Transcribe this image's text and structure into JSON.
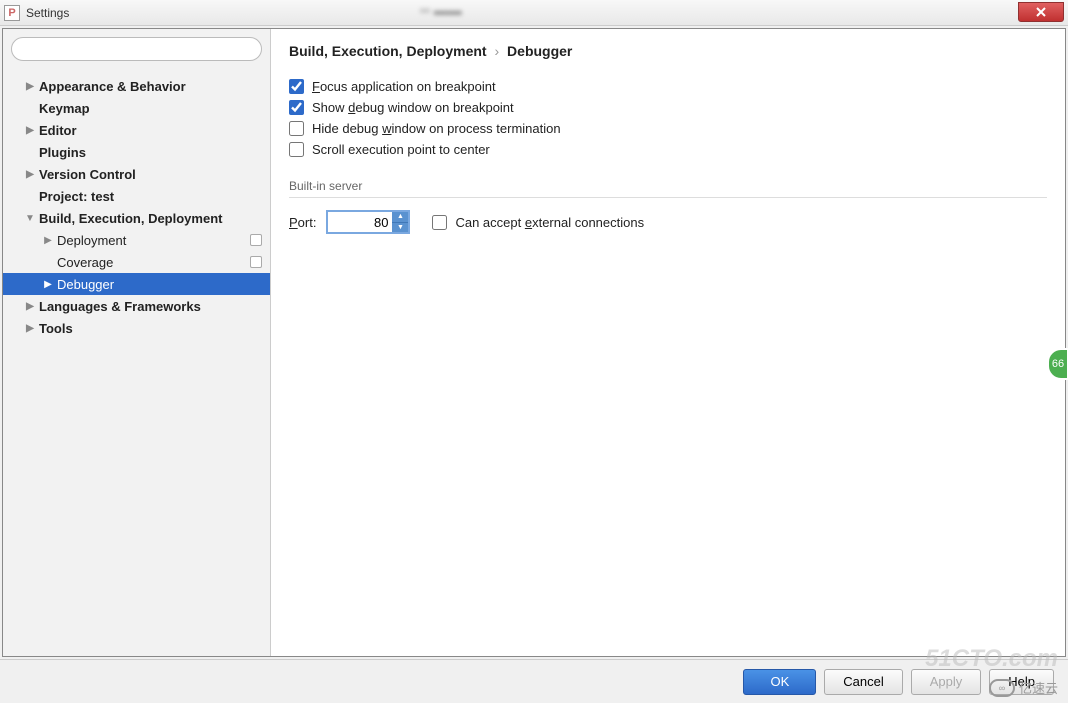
{
  "window": {
    "title": "Settings"
  },
  "sidebar": {
    "search_placeholder": "",
    "items": [
      {
        "label": "Appearance & Behavior",
        "bold": true,
        "arrow": "▶",
        "depth": 1
      },
      {
        "label": "Keymap",
        "bold": true,
        "arrow": "",
        "depth": 1
      },
      {
        "label": "Editor",
        "bold": true,
        "arrow": "▶",
        "depth": 1
      },
      {
        "label": "Plugins",
        "bold": true,
        "arrow": "",
        "depth": 1
      },
      {
        "label": "Version Control",
        "bold": true,
        "arrow": "▶",
        "depth": 1
      },
      {
        "label": "Project: test",
        "bold": true,
        "arrow": "",
        "depth": 1
      },
      {
        "label": "Build, Execution, Deployment",
        "bold": true,
        "arrow": "▼",
        "depth": 1
      },
      {
        "label": "Deployment",
        "bold": false,
        "arrow": "▶",
        "depth": 2,
        "badge": true
      },
      {
        "label": "Coverage",
        "bold": false,
        "arrow": "",
        "depth": 2,
        "badge": true
      },
      {
        "label": "Debugger",
        "bold": false,
        "arrow": "▶",
        "depth": 2,
        "selected": true
      },
      {
        "label": "Languages & Frameworks",
        "bold": true,
        "arrow": "▶",
        "depth": 1
      },
      {
        "label": "Tools",
        "bold": true,
        "arrow": "▶",
        "depth": 1
      }
    ]
  },
  "main": {
    "breadcrumb": {
      "parent": "Build, Execution, Deployment",
      "current": "Debugger"
    },
    "options": [
      {
        "label_pre": "",
        "label_u": "F",
        "label_post": "ocus application on breakpoint",
        "checked": true
      },
      {
        "label_pre": "Show ",
        "label_u": "d",
        "label_post": "ebug window on breakpoint",
        "checked": true
      },
      {
        "label_pre": "Hide debug ",
        "label_u": "w",
        "label_post": "indow on process termination",
        "checked": false
      },
      {
        "label_pre": "Scroll execution point to center",
        "label_u": "",
        "label_post": "",
        "checked": false
      }
    ],
    "section": "Built-in server",
    "port": {
      "label_u": "P",
      "label_post": "ort:",
      "value": "80"
    },
    "external": {
      "label_pre": "Can accept ",
      "label_u": "e",
      "label_post": "xternal connections",
      "checked": false
    }
  },
  "footer": {
    "ok": "OK",
    "cancel": "Cancel",
    "apply": "Apply",
    "help": "Help"
  },
  "watermark": {
    "main": "51CTO.com",
    "sub": "亿速云"
  },
  "sidebadge": "66"
}
